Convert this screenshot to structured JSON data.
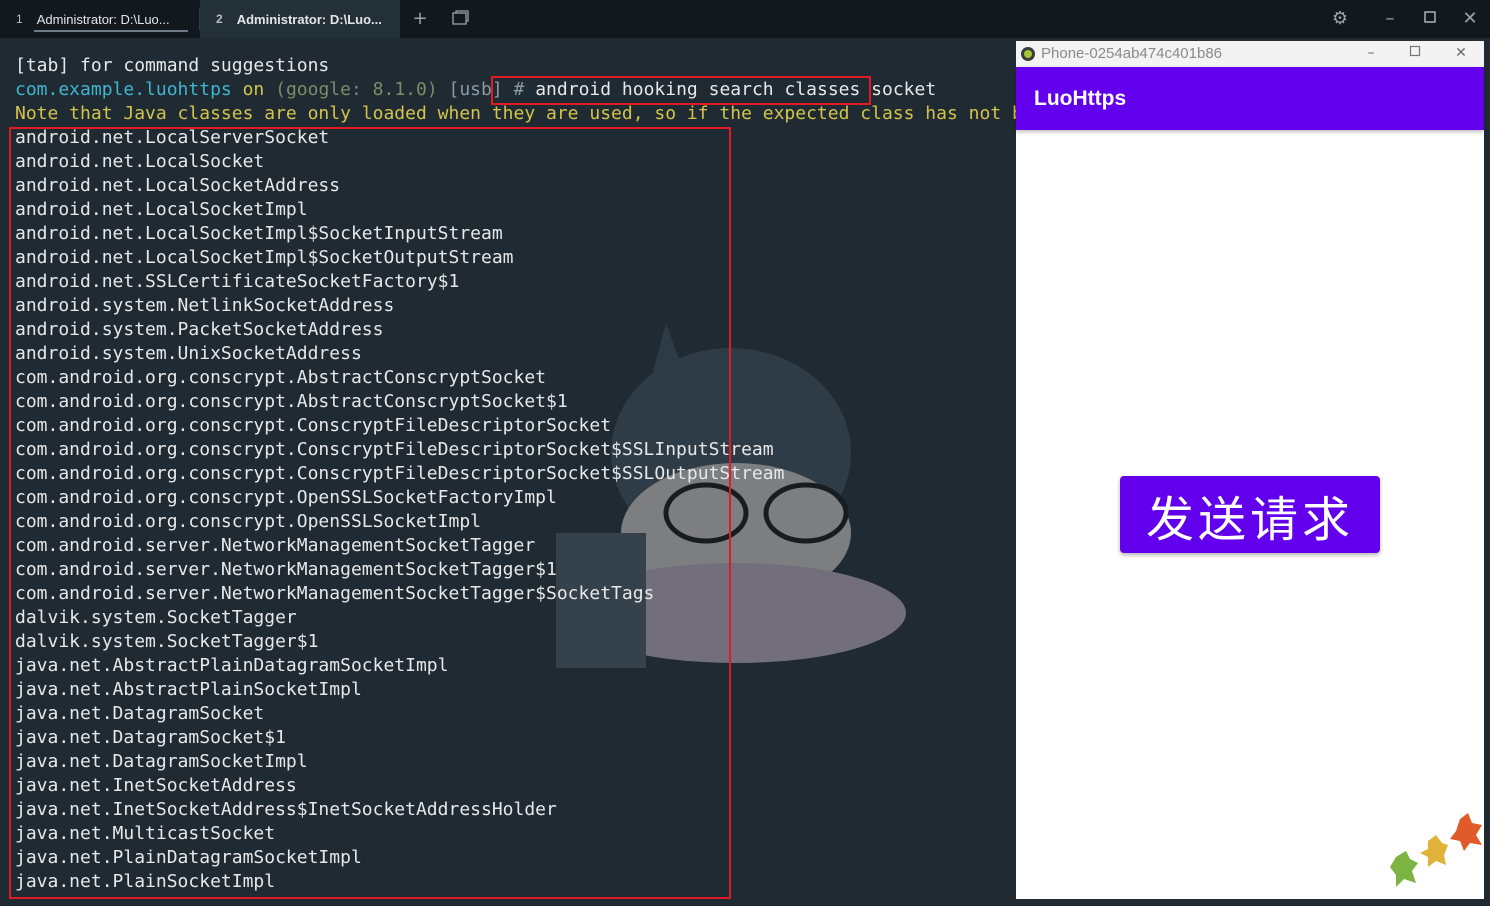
{
  "tabs": [
    {
      "num": "1",
      "label": "Administrator: D:\\Luo..."
    },
    {
      "num": "2",
      "label": "Administrator: D:\\Luo..."
    }
  ],
  "terminal": {
    "hint": "[tab] for command suggestions",
    "prompt": {
      "package": "com.example.luohttps",
      "on": " on ",
      "device": "(google: 8.1.0)",
      "transport": " [usb] # ",
      "command": "android hooking search classes socket"
    },
    "note": "Note that Java classes are only loaded when they are used, so if the expected class has not been fou",
    "classes": [
      "android.net.LocalServerSocket",
      "android.net.LocalSocket",
      "android.net.LocalSocketAddress",
      "android.net.LocalSocketImpl",
      "android.net.LocalSocketImpl$SocketInputStream",
      "android.net.LocalSocketImpl$SocketOutputStream",
      "android.net.SSLCertificateSocketFactory$1",
      "android.system.NetlinkSocketAddress",
      "android.system.PacketSocketAddress",
      "android.system.UnixSocketAddress",
      "com.android.org.conscrypt.AbstractConscryptSocket",
      "com.android.org.conscrypt.AbstractConscryptSocket$1",
      "com.android.org.conscrypt.ConscryptFileDescriptorSocket",
      "com.android.org.conscrypt.ConscryptFileDescriptorSocket$SSLInputStream",
      "com.android.org.conscrypt.ConscryptFileDescriptorSocket$SSLOutputStream",
      "com.android.org.conscrypt.OpenSSLSocketFactoryImpl",
      "com.android.org.conscrypt.OpenSSLSocketImpl",
      "com.android.server.NetworkManagementSocketTagger",
      "com.android.server.NetworkManagementSocketTagger$1",
      "com.android.server.NetworkManagementSocketTagger$SocketTags",
      "dalvik.system.SocketTagger",
      "dalvik.system.SocketTagger$1",
      "java.net.AbstractPlainDatagramSocketImpl",
      "java.net.AbstractPlainSocketImpl",
      "java.net.DatagramSocket",
      "java.net.DatagramSocket$1",
      "java.net.DatagramSocketImpl",
      "java.net.InetSocketAddress",
      "java.net.InetSocketAddress$InetSocketAddressHolder",
      "java.net.MulticastSocket",
      "java.net.PlainDatagramSocketImpl",
      "java.net.PlainSocketImpl"
    ]
  },
  "phone": {
    "window_title": "Phone-0254ab474c401b86",
    "app_title": "LuoHttps",
    "button_label": "发送请求"
  },
  "colors": {
    "terminal_bg": "#1f2a33",
    "accent": "#6200ee",
    "highlight": "#e01b24"
  }
}
